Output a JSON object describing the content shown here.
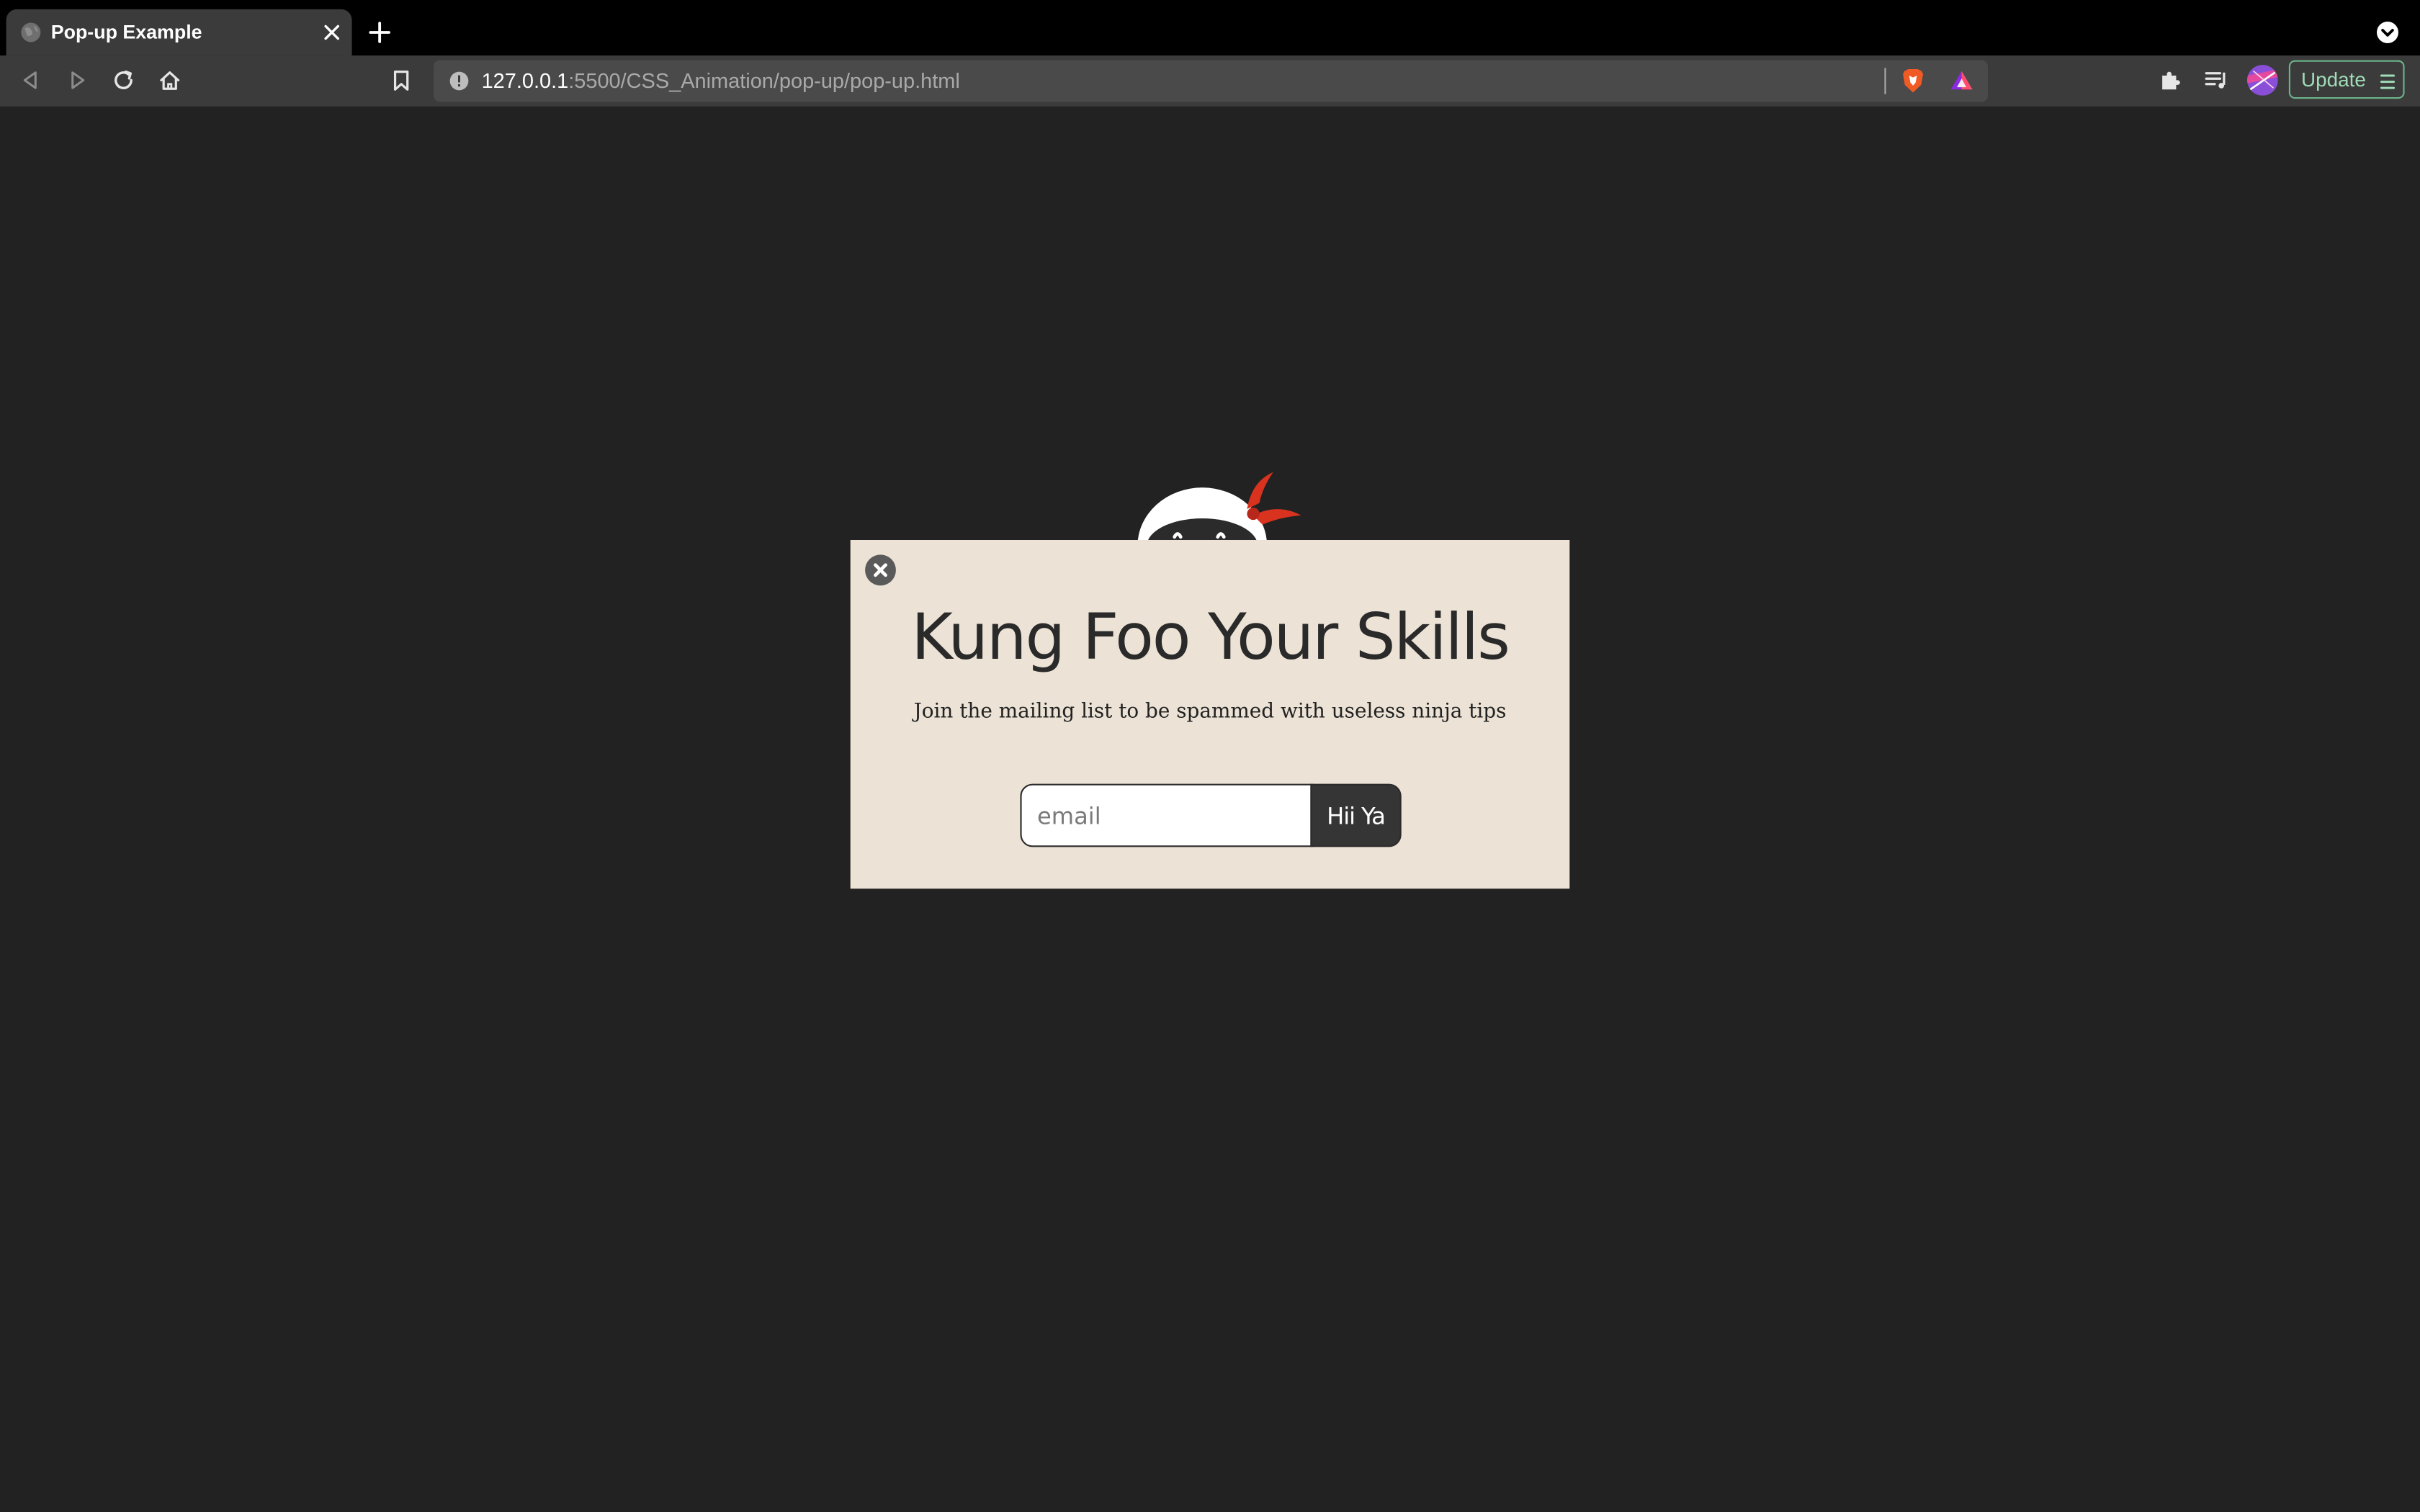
{
  "browser": {
    "tab": {
      "title": "Pop-up Example",
      "favicon": "globe-icon"
    },
    "url": {
      "host": "127.0.0.1",
      "rest": ":5500/CSS_Animation/pop-up/pop-up.html"
    },
    "update_label": "Update"
  },
  "popup": {
    "title": "Kung Foo Your Skills",
    "subtitle": "Join the mailing list to be spammed with useless ninja tips",
    "email_placeholder": "email",
    "submit_label": "Hii Ya"
  },
  "colors": {
    "page_background": "#222222",
    "popup_background": "#ece3d6",
    "button_background": "#353535",
    "update_accent": "#9fdcb7",
    "ninja_headband": "#d9321f"
  }
}
